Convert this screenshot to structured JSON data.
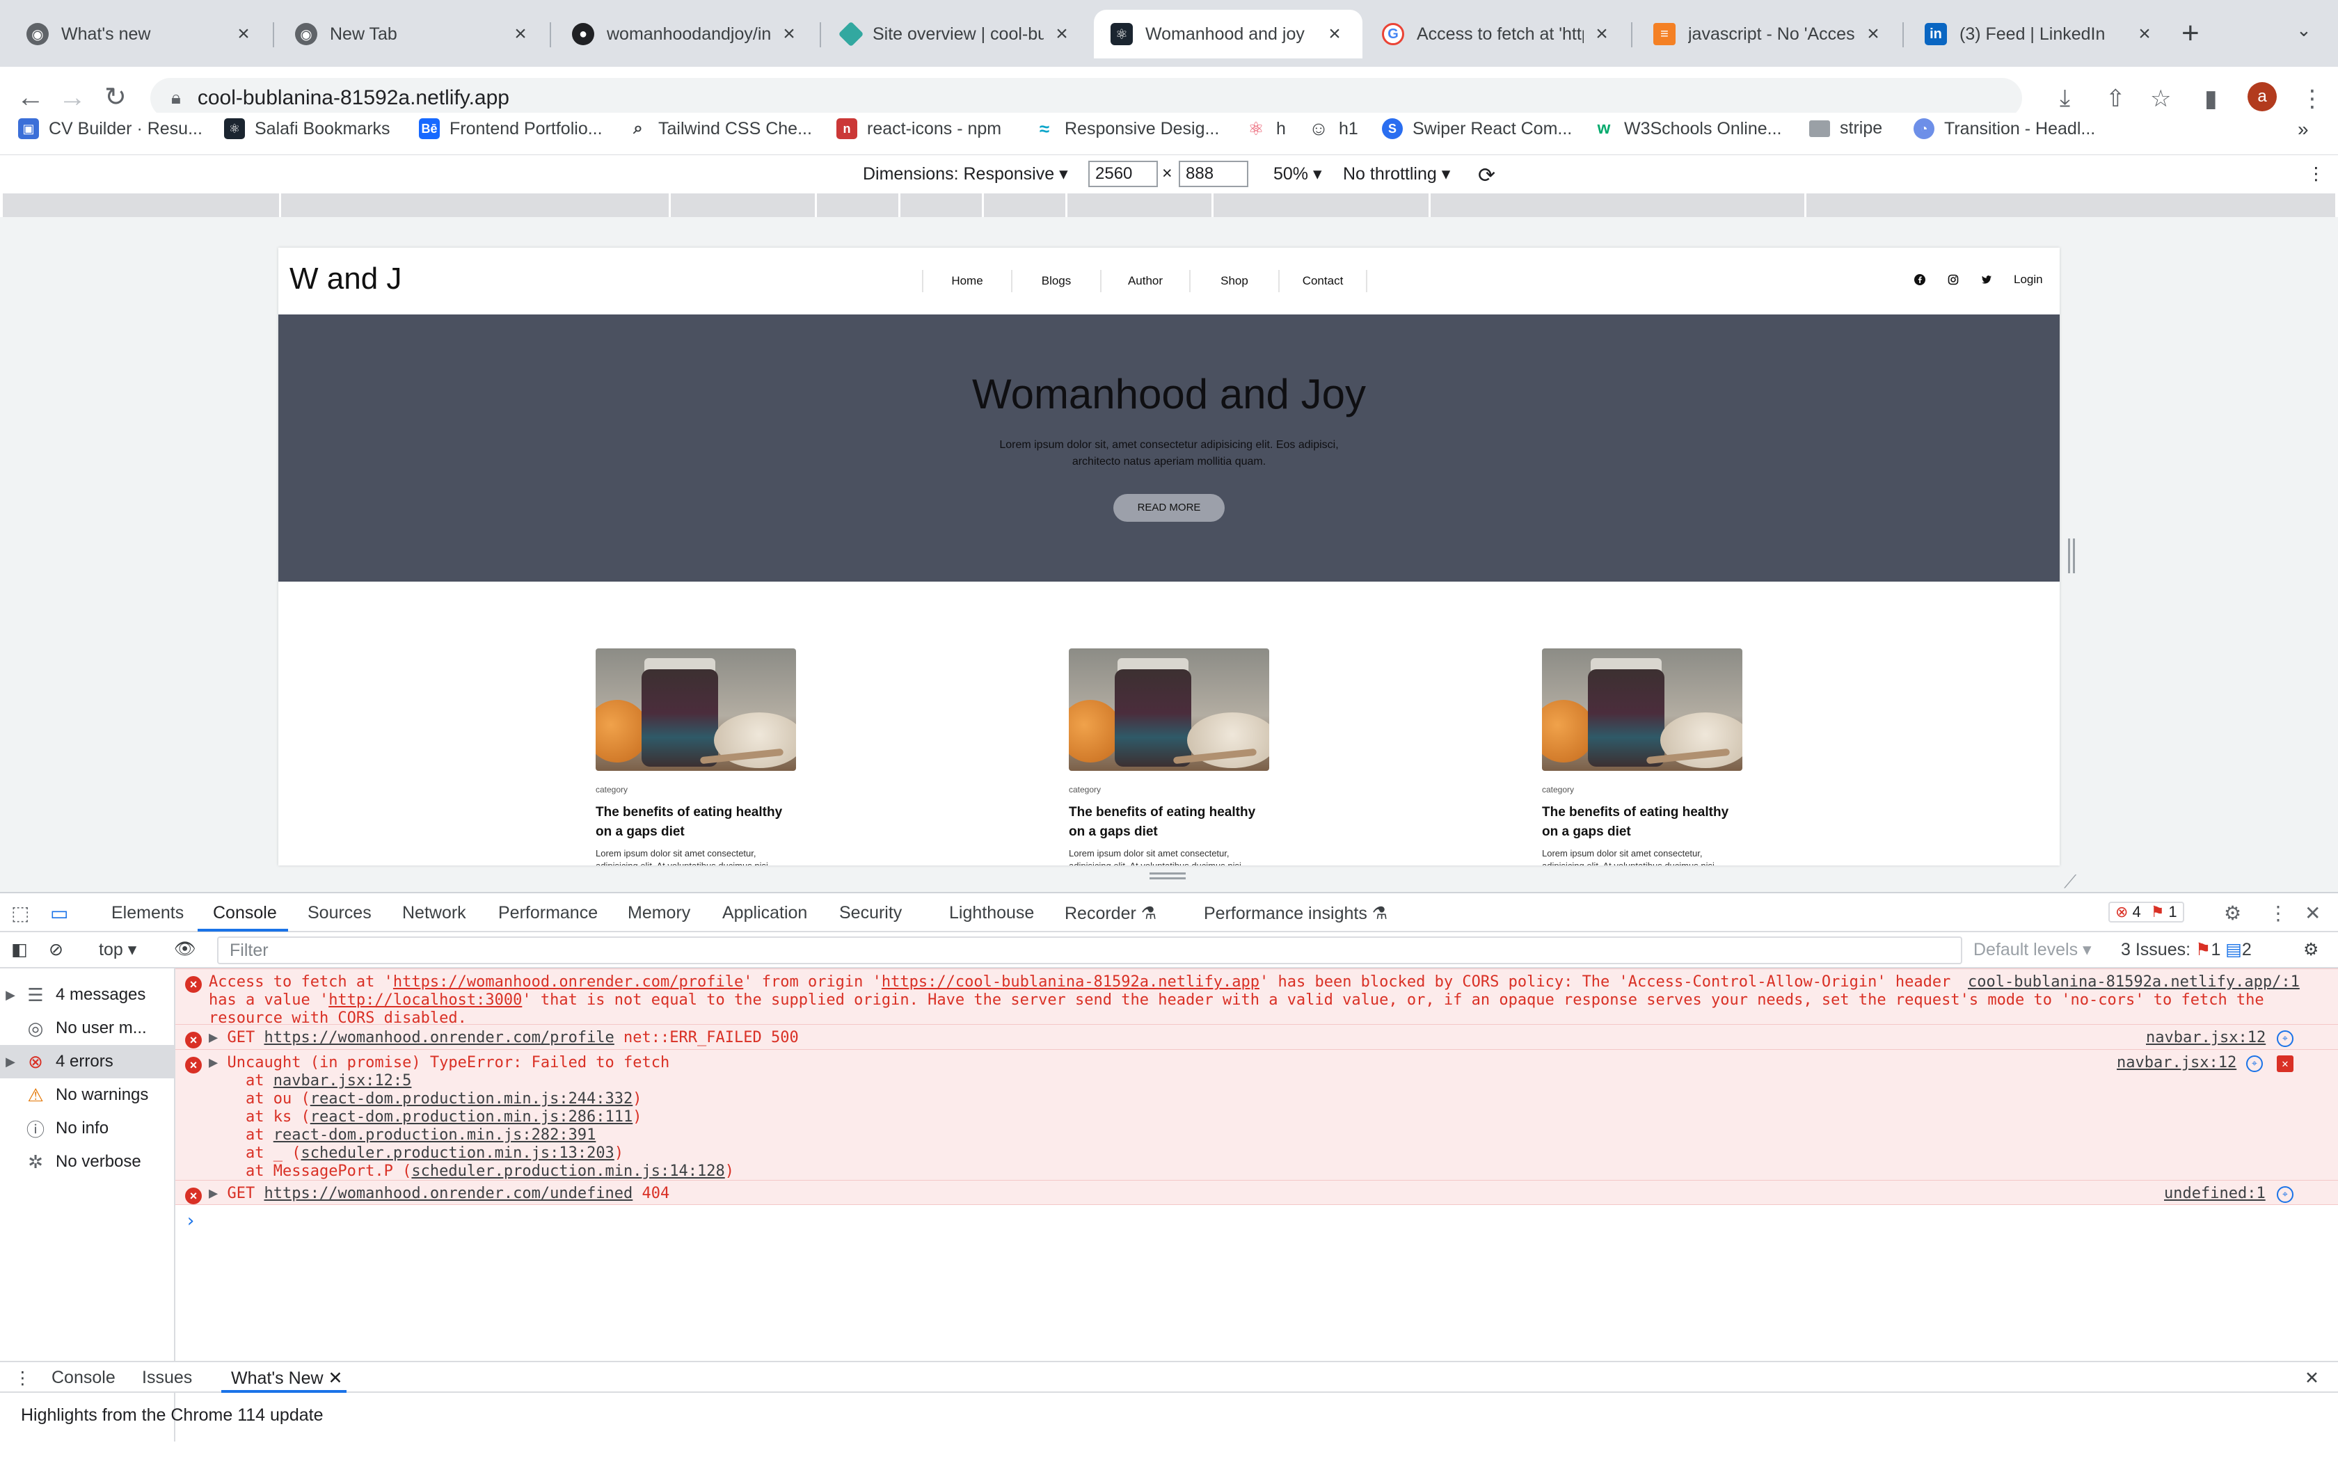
{
  "browser": {
    "tabs": [
      {
        "title": "What's new",
        "icon": "chrome-icon",
        "color": "#5f6368"
      },
      {
        "title": "New Tab",
        "icon": "chrome-icon",
        "color": "#5f6368"
      },
      {
        "title": "womanhoodandjoy/ind",
        "icon": "github-icon",
        "color": "#202124"
      },
      {
        "title": "Site overview | cool-bu",
        "icon": "netlify-icon",
        "color": "#32a8a0"
      },
      {
        "title": "Womanhood and joy",
        "icon": "react-icon",
        "color": "#1b2530"
      },
      {
        "title": "Access to fetch at 'https:",
        "icon": "google-icon",
        "color": "#4285f4"
      },
      {
        "title": "javascript - No 'Access",
        "icon": "stackoverflow-icon",
        "color": "#f48024"
      },
      {
        "title": "(3) Feed | LinkedIn",
        "icon": "linkedin-icon",
        "color": "#0a66c2"
      }
    ],
    "url": "cool-bublanina-81592a.netlify.app",
    "profile_initial": "a",
    "bookmarks": [
      {
        "label": "CV Builder · Resu...",
        "color": "#3b6fd8"
      },
      {
        "label": "Salafi Bookmarks",
        "color": "#1b2530"
      },
      {
        "label": "Frontend Portfolio...",
        "color": "#1769ff"
      },
      {
        "label": "Tailwind CSS Che...",
        "color": "#5f6368"
      },
      {
        "label": "react-icons - npm",
        "color": "#cb3837"
      },
      {
        "label": "Responsive Desig...",
        "color": "#0aa5c9"
      },
      {
        "label": "h",
        "color": "#e84a5f"
      },
      {
        "label": "h1",
        "color": "#5f6368"
      },
      {
        "label": "Swiper React Com...",
        "color": "#2a6ef0"
      },
      {
        "label": "W3Schools Online...",
        "color": "#04aa6d"
      },
      {
        "label": "stripe",
        "color": "#9aa0a6"
      },
      {
        "label": "Transition - Headl...",
        "color": "#6d8fe8"
      }
    ],
    "more_bookmarks": "»"
  },
  "device_toolbar": {
    "dimensions_label": "Dimensions: Responsive",
    "width": "2560",
    "times": "×",
    "height": "888",
    "zoom": "50%",
    "throttling": "No throttling"
  },
  "site": {
    "logo": "W and J",
    "menu": [
      "Home",
      "Blogs",
      "Author",
      "Shop",
      "Contact"
    ],
    "login": "Login",
    "hero_title": "Womanhood and Joy",
    "hero_text": "Lorem ipsum dolor sit, amet consectetur adipisicing elit. Eos adipisci, architecto natus aperiam mollitia quam.",
    "hero_button": "READ MORE",
    "cards": [
      {
        "category": "category",
        "title": "The benefits of eating healthy on a gaps diet",
        "excerpt": "Lorem ipsum dolor sit amet consectetur, adipisicing elit. At voluptatibus ducimus nisi"
      },
      {
        "category": "category",
        "title": "The benefits of eating healthy on a gaps diet",
        "excerpt": "Lorem ipsum dolor sit amet consectetur, adipisicing elit. At voluptatibus ducimus nisi"
      },
      {
        "category": "category",
        "title": "The benefits of eating healthy on a gaps diet",
        "excerpt": "Lorem ipsum dolor sit amet consectetur, adipisicing elit. At voluptatibus ducimus nisi"
      }
    ]
  },
  "devtools": {
    "tabs": [
      "Elements",
      "Console",
      "Sources",
      "Network",
      "Performance",
      "Memory",
      "Application",
      "Security",
      "Lighthouse",
      "Recorder",
      "Performance insights"
    ],
    "error_count": "4",
    "issue_count": "1",
    "context": "top",
    "filter_placeholder": "Filter",
    "default_levels": "Default levels",
    "issues_label": "3 Issues:",
    "issues_errors": "1",
    "issues_info": "2",
    "sidebar": [
      {
        "label": "4 messages",
        "icon": "list-icon"
      },
      {
        "label": "No user m...",
        "icon": "user-icon"
      },
      {
        "label": "4 errors",
        "icon": "error-icon"
      },
      {
        "label": "No warnings",
        "icon": "warning-icon"
      },
      {
        "label": "No info",
        "icon": "info-icon"
      },
      {
        "label": "No verbose",
        "icon": "bug-icon"
      }
    ],
    "messages": {
      "cors_part1": "Access to fetch at '",
      "cors_url1": "https://womanhood.onrender.com/profile",
      "cors_part2": "' from origin '",
      "cors_url2": "https://cool-bublanina-81592a.netlify.app",
      "cors_part3": "' has been blocked by CORS policy: The 'Access-Control-Allow-Origin' header",
      "cors_line2a": "has a value '",
      "cors_url3": "http://localhost:3000",
      "cors_line2b": "' that is not equal to the supplied origin. Have the server send the header with a valid value, or, if an opaque response serves your needs, set the request's mode to 'no-cors' to fetch the",
      "cors_line3": "resource with CORS disabled.",
      "cors_src": "cool-bublanina-81592a.netlify.app/:1",
      "get1_prefix": "GET ",
      "get1_url": "https://womanhood.onrender.com/profile",
      "get1_suffix": " net::ERR_FAILED 500",
      "get1_src": "navbar.jsx:12",
      "type_error": "Uncaught (in promise) TypeError: Failed to fetch",
      "type_src": "navbar.jsx:12",
      "stack": [
        {
          "prefix": "at ",
          "link": "navbar.jsx:12:5",
          "suffix": ""
        },
        {
          "prefix": "at ou (",
          "link": "react-dom.production.min.js:244:332",
          "suffix": ")"
        },
        {
          "prefix": "at ks (",
          "link": "react-dom.production.min.js:286:111",
          "suffix": ")"
        },
        {
          "prefix": "at ",
          "link": "react-dom.production.min.js:282:391",
          "suffix": ""
        },
        {
          "prefix": "at _ (",
          "link": "scheduler.production.min.js:13:203",
          "suffix": ")"
        },
        {
          "prefix": "at MessagePort.P (",
          "link": "scheduler.production.min.js:14:128",
          "suffix": ")"
        }
      ],
      "get2_prefix": "GET ",
      "get2_url": "https://womanhood.onrender.com/undefined",
      "get2_suffix": " 404",
      "get2_src": "undefined:1"
    },
    "drawer_tabs": [
      "Console",
      "Issues",
      "What's New"
    ],
    "whats_new": "Highlights from the Chrome 114 update"
  }
}
